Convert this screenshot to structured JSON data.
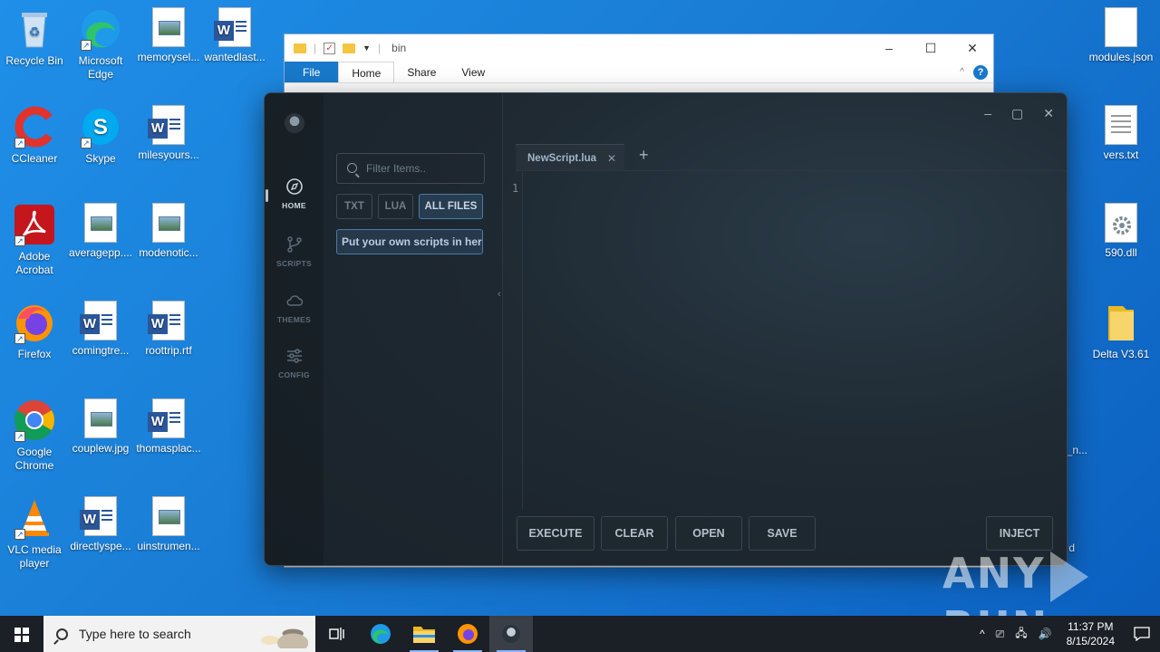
{
  "desktop": {
    "left_icons": [
      {
        "label": "Recycle Bin",
        "icon": "recycle-bin-icon"
      },
      {
        "label": "Microsoft Edge",
        "icon": "edge-icon"
      },
      {
        "label": "memorysel...",
        "icon": "image-file-icon"
      },
      {
        "label": "wantedlast...",
        "icon": "word-doc-icon"
      },
      {
        "label": "CCleaner",
        "icon": "ccleaner-icon"
      },
      {
        "label": "Skype",
        "icon": "skype-icon"
      },
      {
        "label": "milesyours...",
        "icon": "word-doc-icon"
      },
      {
        "label": "Adobe Acrobat",
        "icon": "acrobat-icon"
      },
      {
        "label": "averagepp....",
        "icon": "image-file-icon"
      },
      {
        "label": "modenotic...",
        "icon": "image-file-icon"
      },
      {
        "label": "Firefox",
        "icon": "firefox-icon"
      },
      {
        "label": "comingtre...",
        "icon": "word-doc-icon"
      },
      {
        "label": "roottrip.rtf",
        "icon": "word-doc-icon"
      },
      {
        "label": "Google Chrome",
        "icon": "chrome-icon"
      },
      {
        "label": "couplew.jpg",
        "icon": "image-file-icon"
      },
      {
        "label": "thomasplac...",
        "icon": "word-doc-icon"
      },
      {
        "label": "VLC media player",
        "icon": "vlc-icon"
      },
      {
        "label": "directlyspe...",
        "icon": "word-doc-icon"
      },
      {
        "label": "uinstrumen...",
        "icon": "image-file-icon"
      }
    ],
    "right_icons": [
      {
        "label": "modules.json",
        "icon": "blank-file-icon"
      },
      {
        "label": "vers.txt",
        "icon": "text-file-icon"
      },
      {
        "label": "590.dll",
        "icon": "dll-file-icon"
      },
      {
        "label": "Delta V3.61",
        "icon": "folder-icon"
      }
    ],
    "partial_labels": [
      "_n...",
      "d"
    ]
  },
  "explorer": {
    "title": "bin",
    "ribbon_tabs": [
      "File",
      "Home",
      "Share",
      "View"
    ],
    "help": "?"
  },
  "executor": {
    "nav": [
      {
        "label": "HOME",
        "icon": "compass-icon"
      },
      {
        "label": "SCRIPTS",
        "icon": "branch-icon"
      },
      {
        "label": "THEMES",
        "icon": "cloud-icon"
      },
      {
        "label": "CONFIG",
        "icon": "sliders-icon"
      }
    ],
    "filter_placeholder": "Filter Items..",
    "file_tabs": [
      "TXT",
      "LUA",
      "ALL FILES"
    ],
    "file_item": "Put your own scripts in here",
    "editor_tab": "NewScript.lua",
    "line_number": "1",
    "buttons": {
      "execute": "EXECUTE",
      "clear": "CLEAR",
      "open": "OPEN",
      "save": "SAVE",
      "inject": "INJECT"
    }
  },
  "taskbar": {
    "search_placeholder": "Type here to search",
    "time": "11:37 PM",
    "date": "8/15/2024"
  },
  "watermark": {
    "left": "ANY",
    "right": "RUN"
  }
}
